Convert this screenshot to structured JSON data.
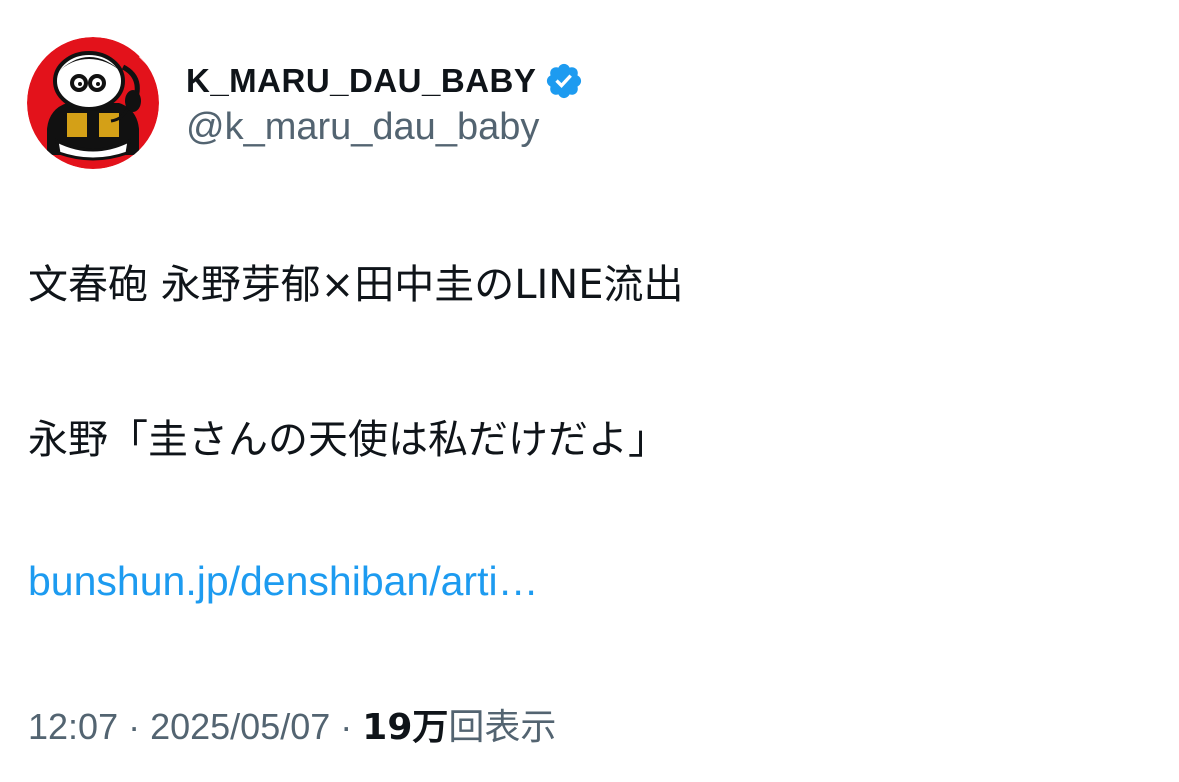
{
  "author": {
    "display_name": "K_MARU_DAU_BABY",
    "handle": "@k_maru_dau_baby",
    "verified_icon": "verified-badge-icon",
    "avatar_icon": "mascot-avatar",
    "verified_color": "#1d9bf0"
  },
  "tweet": {
    "line1": "文春砲 永野芽郁×田中圭のLINE流出",
    "line2": "永野「圭さんの天使は私だけだよ」",
    "link": "bunshun.jp/denshiban/arti…"
  },
  "meta": {
    "time": "12:07",
    "separator": "·",
    "date": "2025/05/07",
    "views_count": "19万",
    "views_label": "回表示"
  },
  "colors": {
    "text": "#0f1419",
    "secondary": "#536471",
    "link": "#1d9bf0",
    "avatar_red": "#e3121b"
  }
}
